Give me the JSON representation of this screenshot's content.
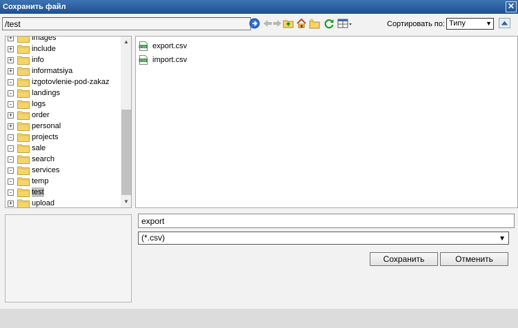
{
  "window": {
    "title": "Сохранить файл",
    "close_symbol": "✕"
  },
  "toolbar": {
    "path": "/test",
    "icons": [
      "go-icon",
      "back-icon",
      "forward-icon",
      "up-folder-icon",
      "home-icon",
      "new-folder-icon",
      "refresh-icon",
      "view-mode-icon"
    ],
    "sort_label": "Сортировать по:",
    "sort_value": "Типу"
  },
  "tree": {
    "items": [
      {
        "label": "images",
        "toggle": "+"
      },
      {
        "label": "include",
        "toggle": "+"
      },
      {
        "label": "info",
        "toggle": "+"
      },
      {
        "label": "informatsiya",
        "toggle": "+"
      },
      {
        "label": "izgotovlenie-pod-zakaz",
        "toggle": "-"
      },
      {
        "label": "landings",
        "toggle": "-"
      },
      {
        "label": "logs",
        "toggle": "-"
      },
      {
        "label": "order",
        "toggle": "+"
      },
      {
        "label": "personal",
        "toggle": "+"
      },
      {
        "label": "projects",
        "toggle": "-"
      },
      {
        "label": "sale",
        "toggle": "-"
      },
      {
        "label": "search",
        "toggle": "-"
      },
      {
        "label": "services",
        "toggle": "-"
      },
      {
        "label": "temp",
        "toggle": "-"
      },
      {
        "label": "test",
        "toggle": "-",
        "selected": true
      },
      {
        "label": "upload",
        "toggle": "+"
      }
    ]
  },
  "files": {
    "icon_text": "CSV",
    "items": [
      {
        "name": "export.csv"
      },
      {
        "name": "import.csv"
      }
    ]
  },
  "form": {
    "filename": "export",
    "filetype": "(*.csv)",
    "save_label": "Сохранить",
    "cancel_label": "Отменить"
  },
  "colors": {
    "titlebar": "#2a5d9f",
    "folder": "#f5d46b",
    "selected_bg": "#bdbdbd"
  }
}
